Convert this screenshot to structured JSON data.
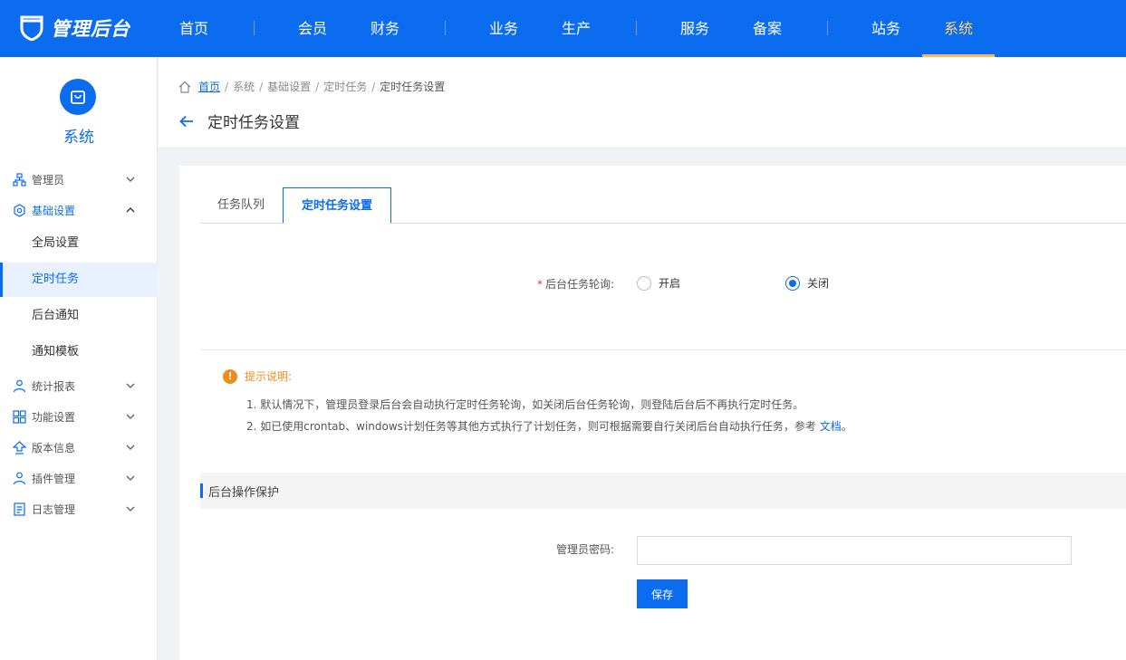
{
  "topbar": {
    "logo_text": "管理后台",
    "nav": [
      {
        "label": "首页"
      },
      {
        "label": "会员"
      },
      {
        "label": "财务"
      },
      {
        "label": "业务"
      },
      {
        "label": "生产"
      },
      {
        "label": "服务"
      },
      {
        "label": "备案"
      },
      {
        "label": "站务"
      },
      {
        "label": "系统",
        "active": true
      }
    ]
  },
  "sidebar": {
    "title": "系统",
    "groups": [
      {
        "label": "管理员",
        "icon": "org-chart-icon",
        "open": false
      },
      {
        "label": "基础设置",
        "icon": "settings-hex-icon",
        "open": true
      },
      {
        "label": "统计报表",
        "icon": "report-icon",
        "open": false
      },
      {
        "label": "功能设置",
        "icon": "grid-icon",
        "open": false
      },
      {
        "label": "版本信息",
        "icon": "upload-icon",
        "open": false
      },
      {
        "label": "插件管理",
        "icon": "plugin-icon",
        "open": false
      },
      {
        "label": "日志管理",
        "icon": "log-icon",
        "open": false
      }
    ],
    "sub_items": [
      {
        "label": "全局设置"
      },
      {
        "label": "定时任务",
        "active": true
      },
      {
        "label": "后台通知"
      },
      {
        "label": "通知模板"
      }
    ]
  },
  "breadcrumb": {
    "home": "首页",
    "items": [
      "系统",
      "基础设置",
      "定时任务",
      "定时任务设置"
    ]
  },
  "page": {
    "title": "定时任务设置"
  },
  "tabs": [
    {
      "label": "任务队列"
    },
    {
      "label": "定时任务设置",
      "active": true
    }
  ],
  "form": {
    "poll_label": "后台任务轮询:",
    "poll_required": "*",
    "options": [
      {
        "label": "开启",
        "checked": false
      },
      {
        "label": "关闭",
        "checked": true
      }
    ]
  },
  "tips": {
    "title": "提示说明:",
    "lines": [
      "1. 默认情况下，管理员登录后台会自动执行定时任务轮询，如关闭后台任务轮询，则登陆后台后不再执行定时任务。",
      "2. 如已使用crontab、windows计划任务等其他方式执行了计划任务，则可根据需要自行关闭后台自动执行任务，参考"
    ],
    "link_text": "文档",
    "trailing": "。"
  },
  "protect": {
    "section_title": "后台操作保护",
    "password_label": "管理员密码:",
    "password_value": "",
    "save_label": "保存"
  },
  "colors": {
    "primary": "#0b6cf0",
    "active_nav": "#ffd48a",
    "warning": "#f08c1e",
    "required": "#e53935"
  }
}
